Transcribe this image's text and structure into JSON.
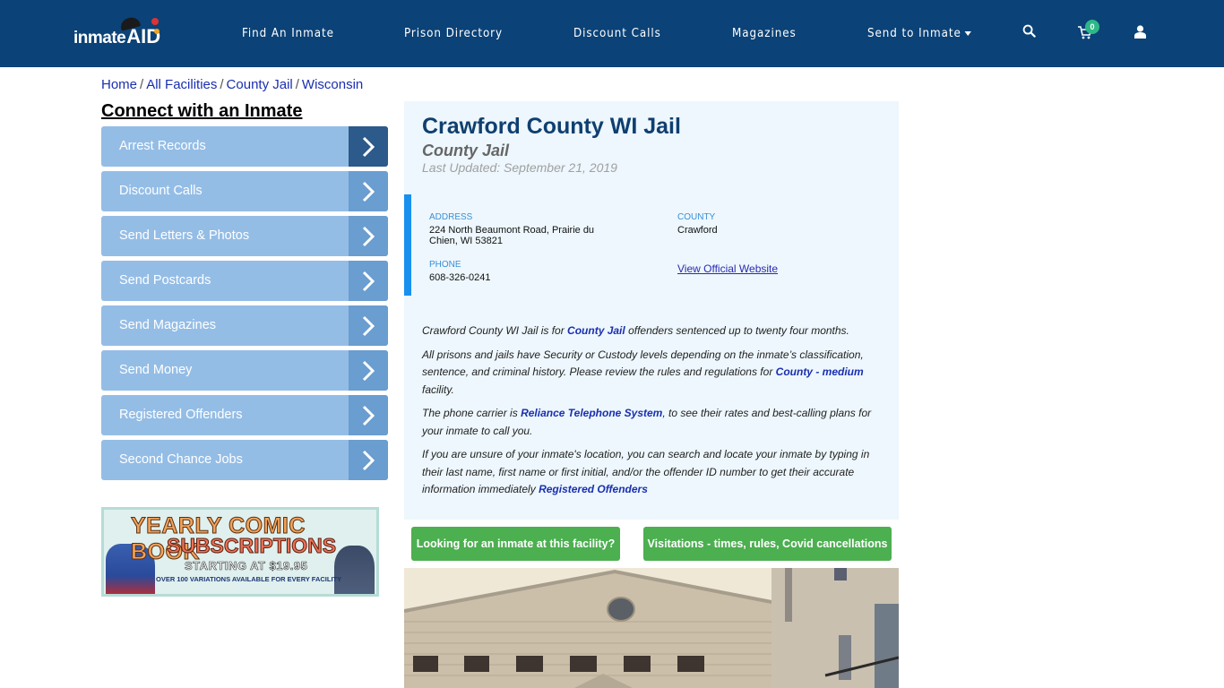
{
  "navbar": {
    "logo_text": "inmate",
    "logo_accent": "AID",
    "items": [
      {
        "label": "Find An Inmate"
      },
      {
        "label": "Prison Directory"
      },
      {
        "label": "Discount Calls"
      },
      {
        "label": "Magazines"
      },
      {
        "label": "Send to Inmate",
        "has_dropdown": true
      }
    ],
    "icons": {
      "search": "search-icon",
      "cart": "cart-icon",
      "user": "user-icon"
    },
    "cart_count": "0",
    "bg_color": "#0b4277"
  },
  "breadcrumb": [
    {
      "label": "Home"
    },
    {
      "label": "All Facilities"
    },
    {
      "label": "County Jail"
    },
    {
      "label": "Wisconsin"
    }
  ],
  "sidebar": {
    "title": "Connect with an Inmate",
    "items": [
      {
        "label": "Arrest Records",
        "active": true
      },
      {
        "label": "Discount Calls"
      },
      {
        "label": "Send Letters & Photos"
      },
      {
        "label": "Send Postcards"
      },
      {
        "label": "Send Magazines"
      },
      {
        "label": "Send Money"
      },
      {
        "label": "Registered Offenders"
      },
      {
        "label": "Second Chance Jobs"
      }
    ],
    "ad": {
      "line1": "YEARLY COMIC BOOK",
      "line2": "SUBSCRIPTIONS",
      "line3": "STARTING AT $19.95",
      "line4": "OVER 100 VARIATIONS AVAILABLE FOR EVERY FACILITY"
    }
  },
  "facility": {
    "name": "Crawford County WI Jail",
    "type": "County Jail",
    "last_updated": "Last Updated: September 21, 2019",
    "address_label": "ADDRESS",
    "address_line1": "224 North Beaumont Road, Prairie du",
    "address_line2": "Chien, WI 53821",
    "county_label": "COUNTY",
    "county": "Crawford",
    "phone_label": "PHONE",
    "phone": "608-326-0241",
    "website_link": "View Official Website"
  },
  "description": {
    "p1_a": "Crawford County WI Jail is for ",
    "p1_link": "County Jail",
    "p1_b": " offenders sentenced up to twenty four months.",
    "p2_a": "All prisons and jails have Security or Custody levels depending on the inmate’s classification, sentence, and criminal history. Please review the rules and regulations for ",
    "p2_link": "County - medium",
    "p2_b": " facility.",
    "p3_a": "The phone carrier is ",
    "p3_link": "Reliance Telephone System",
    "p3_b": ", to see their rates and best-calling plans for your inmate to call you.",
    "p4_a": "If you are unsure of your inmate's location, you can search and locate your inmate by typing in their last name, first name or first initial, and/or the offender ID number to get their accurate information immediately ",
    "p4_link": "Registered Offenders"
  },
  "buttons": {
    "find_inmate": "Looking for an inmate at this facility?",
    "visitations": "Visitations - times, rules, Covid cancellations"
  }
}
